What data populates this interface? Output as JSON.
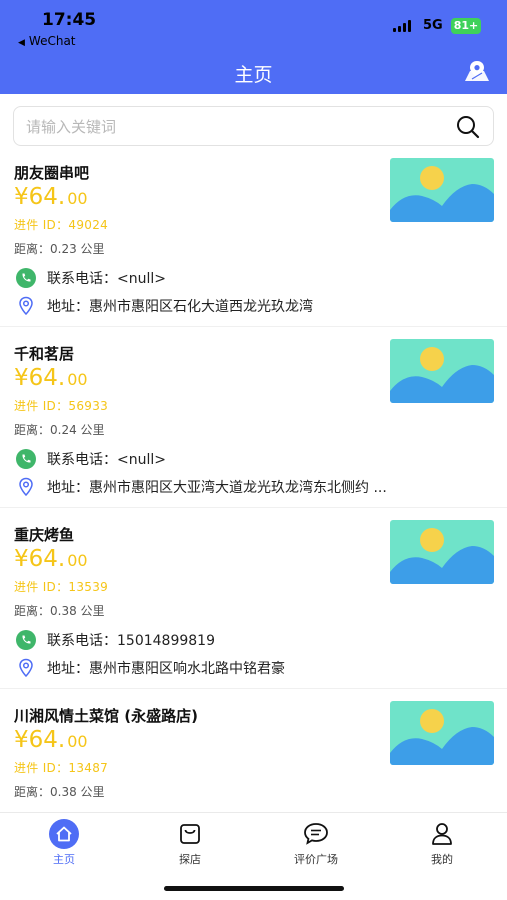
{
  "status_bar": {
    "time": "17:45",
    "back_app": "WeChat",
    "network": "5G",
    "battery": "81+"
  },
  "header": {
    "title": "主页",
    "map_icon": "map-pin-icon"
  },
  "search": {
    "placeholder": "请输入关键词",
    "value": ""
  },
  "stores": [
    {
      "name": "朋友圈串吧",
      "price_symbol": "¥",
      "price_main": "64.",
      "price_cents": "00",
      "id_line": "进件 ID：49024",
      "distance": "距离：0.23 公里",
      "phone": "联系电话：<null>",
      "address": "地址：惠州市惠阳区石化大道西龙光玖龙湾"
    },
    {
      "name": "千和茗居",
      "price_symbol": "¥",
      "price_main": "64.",
      "price_cents": "00",
      "id_line": "进件 ID：56933",
      "distance": "距离：0.24 公里",
      "phone": "联系电话：<null>",
      "address": "地址：惠州市惠阳区大亚湾大道龙光玖龙湾东北侧约 ..."
    },
    {
      "name": "重庆烤鱼",
      "price_symbol": "¥",
      "price_main": "64.",
      "price_cents": "00",
      "id_line": "进件 ID：13539",
      "distance": "距离：0.38 公里",
      "phone": "联系电话：15014899819",
      "address": "地址：惠州市惠阳区响水北路中铭君豪"
    },
    {
      "name": "川湘风情土菜馆 (永盛路店)",
      "price_symbol": "¥",
      "price_main": "64.",
      "price_cents": "00",
      "id_line": "进件 ID：13487",
      "distance": "距离：0.38 公里",
      "phone": "",
      "address": ""
    }
  ],
  "tabs": [
    {
      "label": "主页",
      "icon": "home-icon",
      "active": true
    },
    {
      "label": "探店",
      "icon": "shopping-bag-icon",
      "active": false
    },
    {
      "label": "评价广场",
      "icon": "chat-bubble-icon",
      "active": false
    },
    {
      "label": "我的",
      "icon": "user-icon",
      "active": false
    }
  ],
  "colors": {
    "primary": "#4f6df5",
    "price": "#f5c518",
    "wechat_green": "#3fb66a",
    "battery": "#3fd15a"
  }
}
